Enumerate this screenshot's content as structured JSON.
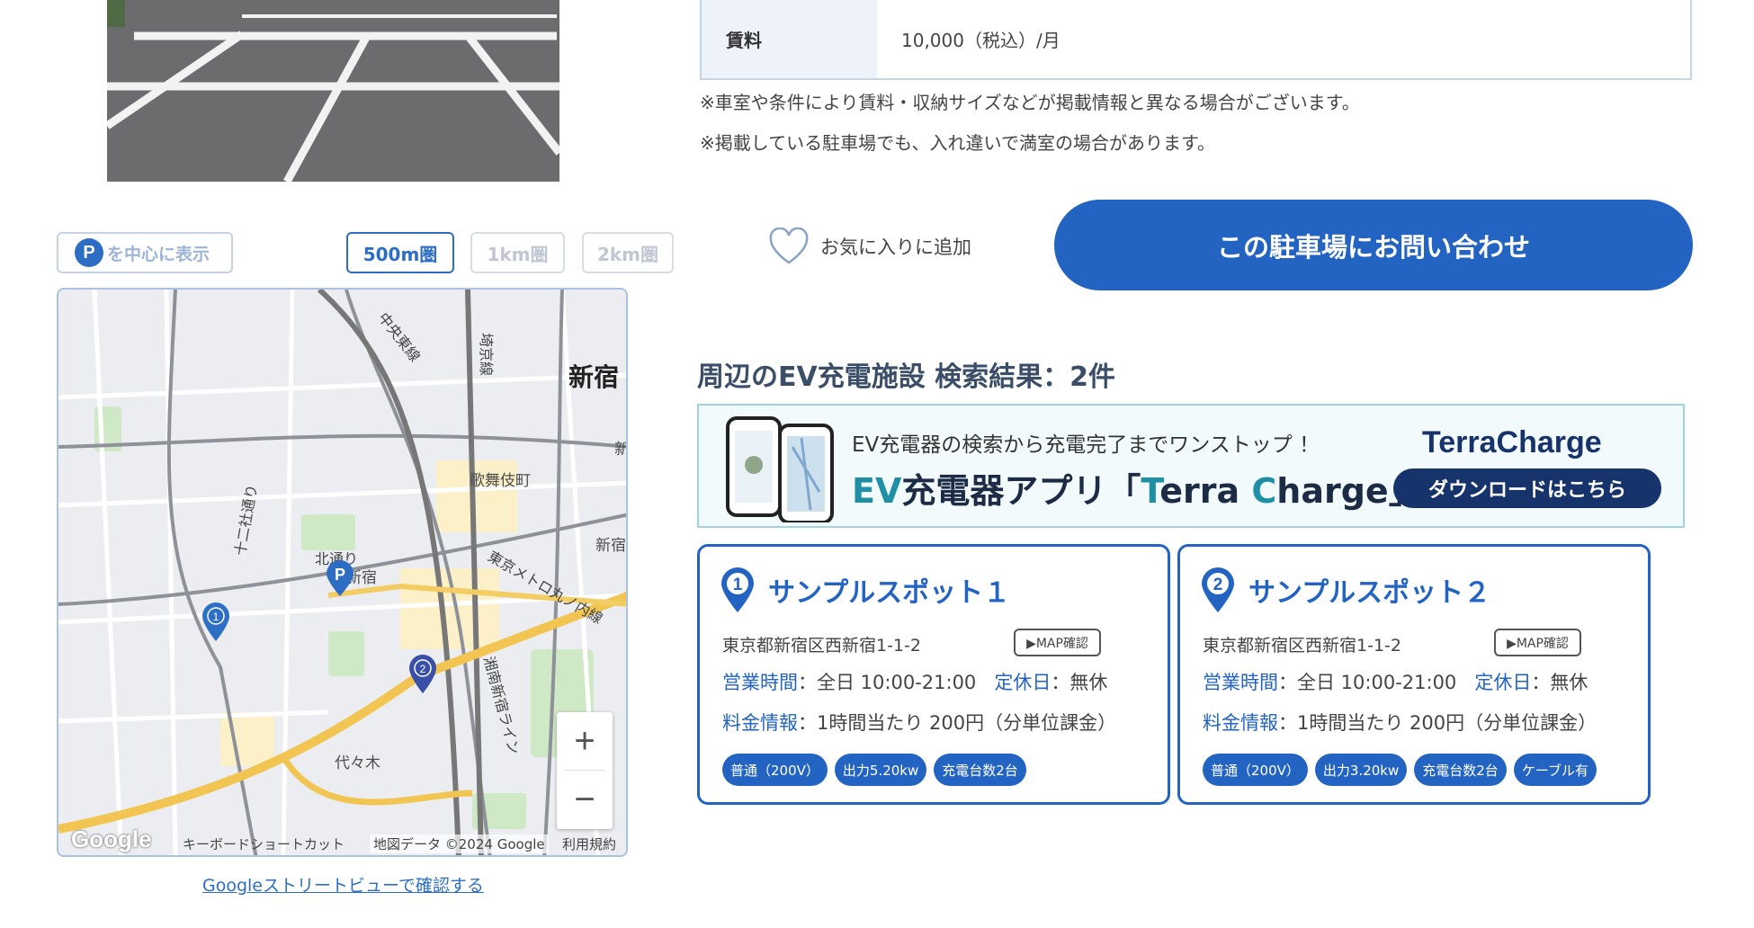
{
  "map_controls": {
    "center_label": "を中心に表示",
    "center_icon_letter": "P",
    "radius_options": [
      "500m圏",
      "1km圏",
      "2km圏"
    ],
    "active_radius": "500m圏"
  },
  "map": {
    "labels": {
      "shinjuku": "新宿",
      "kabukicho": "歌舞伎町",
      "chuo_line": "中央東線",
      "saikyo_line": "埼京線",
      "juniso": "十二社通り",
      "kita_dori": "北通り",
      "nishi_shinjuku": "新宿",
      "marunouchi": "東京メトロ丸ノ内線",
      "shonan": "湘南新宿ライン",
      "yoyogi": "代々木",
      "shinjuku_right": "新宿",
      "edge_right": "新",
      "edge_right2": "新宿"
    },
    "pins": [
      {
        "number": "1",
        "color": "#2e6fc6"
      },
      {
        "number": "2",
        "color": "#3a4fa8"
      }
    ],
    "zoom_in": "+",
    "zoom_out": "−",
    "google_logo": "Google",
    "keyboard_shortcuts": "キーボードショートカット",
    "attribution": "地図データ ©2024 Google",
    "terms": "利用規約"
  },
  "streetview_link": "Googleストリートビューで確認する",
  "fee": {
    "label": "賃料",
    "value": "10,000（税込）/月"
  },
  "notes": [
    "※車室や条件により賃料・収納サイズなどが掲載情報と異なる場合がございます。",
    "※掲載している駐車場でも、入れ違いで満室の場合があります。"
  ],
  "favorite_label": "お気に入りに追加",
  "contact_button": "この駐車場にお問い合わせ",
  "ev_heading": "周辺のEV充電施設 検索結果：2件",
  "banner": {
    "sub": "EV充電器の検索から充電完了までワンストップ ！",
    "main_prefix": "EV",
    "main_mid": "充電器アプリ「",
    "main_t": "T",
    "main_erra": "erra ",
    "main_c": "C",
    "main_suffix": "harge」",
    "brand": "TerraCharge",
    "download": "ダウンロードはこちら"
  },
  "spots": [
    {
      "number": "1",
      "title": "サンプルスポット１",
      "address": "東京都新宿区西新宿1-1-2",
      "map_button": "▶MAP確認",
      "hours_label": "営業時間",
      "hours": "：全日 10:00-21:00",
      "closed_label": "定休日",
      "closed": "：無休",
      "price_label": "料金情報",
      "price": "：1時間当たり 200円（分単位課金）",
      "tags": [
        "普通（200V）",
        "出力5.20kw",
        "充電台数2台"
      ]
    },
    {
      "number": "2",
      "title": "サンプルスポット２",
      "address": "東京都新宿区西新宿1-1-2",
      "map_button": "▶MAP確認",
      "hours_label": "営業時間",
      "hours": "：全日 10:00-21:00",
      "closed_label": "定休日",
      "closed": "：無休",
      "price_label": "料金情報",
      "price": "：1時間当たり 200円（分単位課金）",
      "tags": [
        "普通（200V）",
        "出力3.20kw",
        "充電台数2台",
        "ケーブル有"
      ]
    }
  ],
  "colors": {
    "primary": "#2364c2",
    "heading": "#3b4e68",
    "banner_navy": "#17336b",
    "banner_teal": "#1f8fa6"
  }
}
